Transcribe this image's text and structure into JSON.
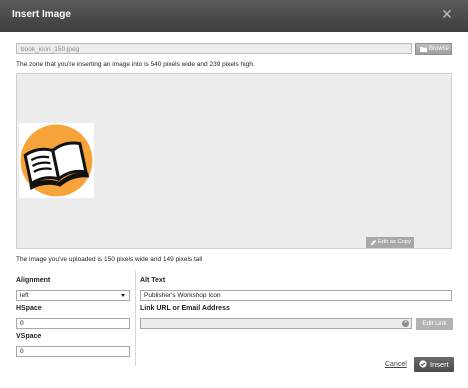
{
  "dialog": {
    "title": "Insert Image"
  },
  "file": {
    "value": "book_icon_150.jpeg",
    "browse_label": "Browse"
  },
  "zone_info": "The zone that you're inserting an image into is 540 pixels wide and 239 pixels high.",
  "preview": {
    "edit_as_copy_label": "Edit as Copy"
  },
  "uploaded_info": "The image you've uploaded is 150 pixels wide and 149 pixels tall",
  "form": {
    "alignment_label": "Alignment",
    "alignment_value": "left",
    "hspace_label": "HSpace",
    "hspace_value": "0",
    "vspace_label": "VSpace",
    "vspace_value": "0",
    "alt_text_label": "Alt Text",
    "alt_text_value": "Publisher's Workshop Icon",
    "link_label": "Link URL or Email Address",
    "link_value": "",
    "edit_link_label": "Edit Link"
  },
  "footer": {
    "cancel_label": "Cancel",
    "insert_label": "Insert"
  },
  "colors": {
    "titlebar": "#4a4a4a",
    "book_circle": "#f6a43a",
    "button_gray": "#a8a8a8"
  }
}
